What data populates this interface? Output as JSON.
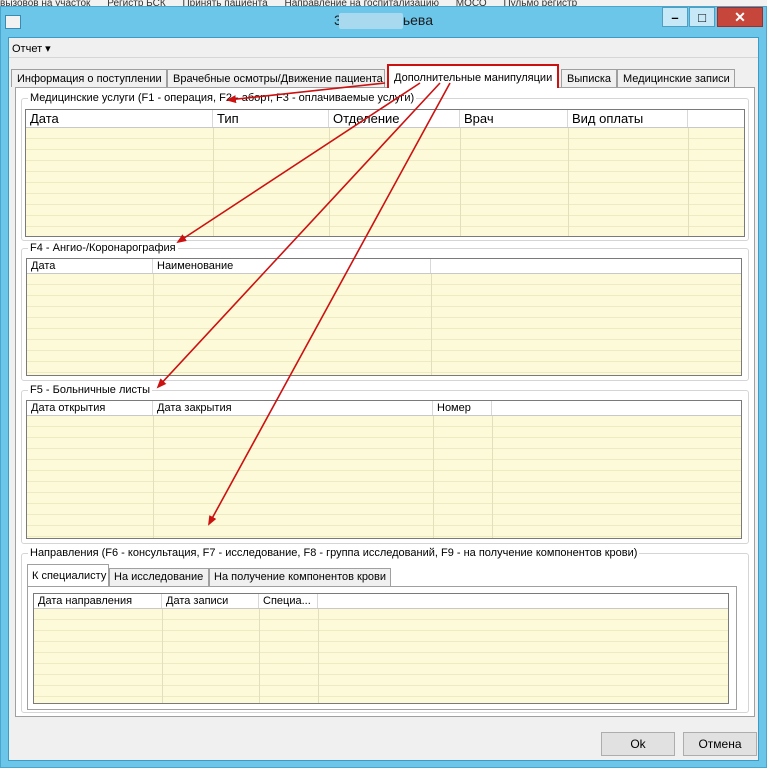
{
  "background_strip": [
    "вызовов на участок",
    "Регистр БСК",
    "Принять пациента",
    "Направление на госпитализацию",
    "МОСО",
    "Пульмо регистр"
  ],
  "window": {
    "title": "34 - Савельева",
    "min_glyph": "–",
    "max_glyph": "□",
    "close_glyph": "✕"
  },
  "menu": {
    "report": "Отчет ▾"
  },
  "tabs": [
    {
      "label": "Информация о поступлении"
    },
    {
      "label": "Врачебные осмотры/Движение пациента"
    },
    {
      "label": "Дополнительные манипуляции"
    },
    {
      "label": "Выписка"
    },
    {
      "label": "Медицинские записи"
    }
  ],
  "groups": {
    "services": {
      "title": "Медицинские услуги (F1 - операция, F2 - аборт, F3 - оплачиваемые услуги)",
      "columns": [
        "Дата",
        "Тип",
        "Отделение",
        "Врач",
        "Вид оплаты",
        ""
      ]
    },
    "angio": {
      "title": "F4 - Ангио-/Коронарография",
      "columns": [
        "Дата",
        "Наименование",
        ""
      ]
    },
    "sick": {
      "title": "F5 - Больничные листы",
      "columns": [
        "Дата открытия",
        "Дата закрытия",
        "Номер",
        ""
      ]
    },
    "directions": {
      "title": "Направления (F6 - консультация, F7 - исследование, F8 - группа исследований, F9 - на получение компонентов крови)",
      "subtabs": [
        "К специалисту",
        "На исследование",
        "На получение компонентов крови"
      ],
      "columns": [
        "Дата направления",
        "Дата записи",
        "Специа...",
        ""
      ]
    }
  },
  "buttons": {
    "ok": "Ok",
    "cancel": "Отмена"
  },
  "colors": {
    "titlebar": "#6cc6ea",
    "grid_background": "#fdfad9",
    "annotation": "#cc1111",
    "close_button": "#c7463c"
  }
}
